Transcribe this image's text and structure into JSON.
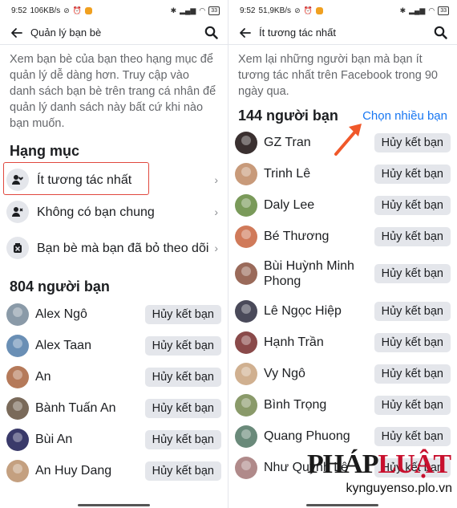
{
  "left": {
    "status": {
      "time": "9:52",
      "speed": "106KB/s",
      "battery": "33"
    },
    "appbar": {
      "title": "Quản lý bạn bè"
    },
    "description": "Xem bạn bè của bạn theo hạng mục để quản lý dễ dàng hơn. Truy cập vào danh sách bạn bè trên trang cá nhân để quản lý danh sách này bất cứ khi nào bạn muốn.",
    "categories_title": "Hạng mục",
    "categories": [
      {
        "label": "Ít tương tác nhất",
        "icon": "person-heart-icon"
      },
      {
        "label": "Không có bạn chung",
        "icon": "person-x-icon"
      },
      {
        "label": "Bạn bè mà bạn đã bỏ theo dõi",
        "icon": "unfollow-icon"
      }
    ],
    "friends_count": "804 người bạn",
    "unfriend_label": "Hủy kết bạn",
    "friends": [
      {
        "name": "Alex Ngô",
        "color": "#8a9aa8"
      },
      {
        "name": "Alex Taan",
        "color": "#6a8fb5"
      },
      {
        "name": "An",
        "color": "#b57a5a"
      },
      {
        "name": "Bành Tuấn An",
        "color": "#7a6a5a"
      },
      {
        "name": "Bùi An",
        "color": "#3a3a6a"
      },
      {
        "name": "An Huy Dang",
        "color": "#c4a080"
      }
    ]
  },
  "right": {
    "status": {
      "time": "9:52",
      "speed": "51,9KB/s",
      "battery": "33"
    },
    "appbar": {
      "title": "Ít tương tác nhất"
    },
    "description": "Xem lại những người bạn mà bạn ít tương tác nhất trên Facebook trong 90 ngày qua.",
    "friends_count": "144 người bạn",
    "select_many": "Chọn nhiều bạn",
    "unfriend_label": "Hủy kết bạn",
    "friends": [
      {
        "name": "GZ Tran",
        "color": "#3a3030"
      },
      {
        "name": "Trinh Lê",
        "color": "#c89a7a"
      },
      {
        "name": "Daly Lee",
        "color": "#7a9a5a"
      },
      {
        "name": "Bé Thương",
        "color": "#d07a5a"
      },
      {
        "name": "Bùi Huỳnh Minh Phong",
        "color": "#9a6a5a"
      },
      {
        "name": "Lê Ngọc Hiệp",
        "color": "#4a4a5a"
      },
      {
        "name": "Hạnh Trần",
        "color": "#8a4a4a"
      },
      {
        "name": "Vy Ngô",
        "color": "#d0b090"
      },
      {
        "name": "Bình Trọng",
        "color": "#8a9a6a"
      },
      {
        "name": "Quang Phuong",
        "color": "#6a8a7a"
      },
      {
        "name": "Như Quỳnh Lê",
        "color": "#b08a8a"
      }
    ]
  },
  "watermark": {
    "logo_main": "PHÁP",
    "logo_accent": "LUẬT",
    "url": "kynguyenso.plo.vn"
  },
  "colors": {
    "accent": "#1877f2",
    "highlight": "#e0483e",
    "arrow": "#f0582a"
  }
}
